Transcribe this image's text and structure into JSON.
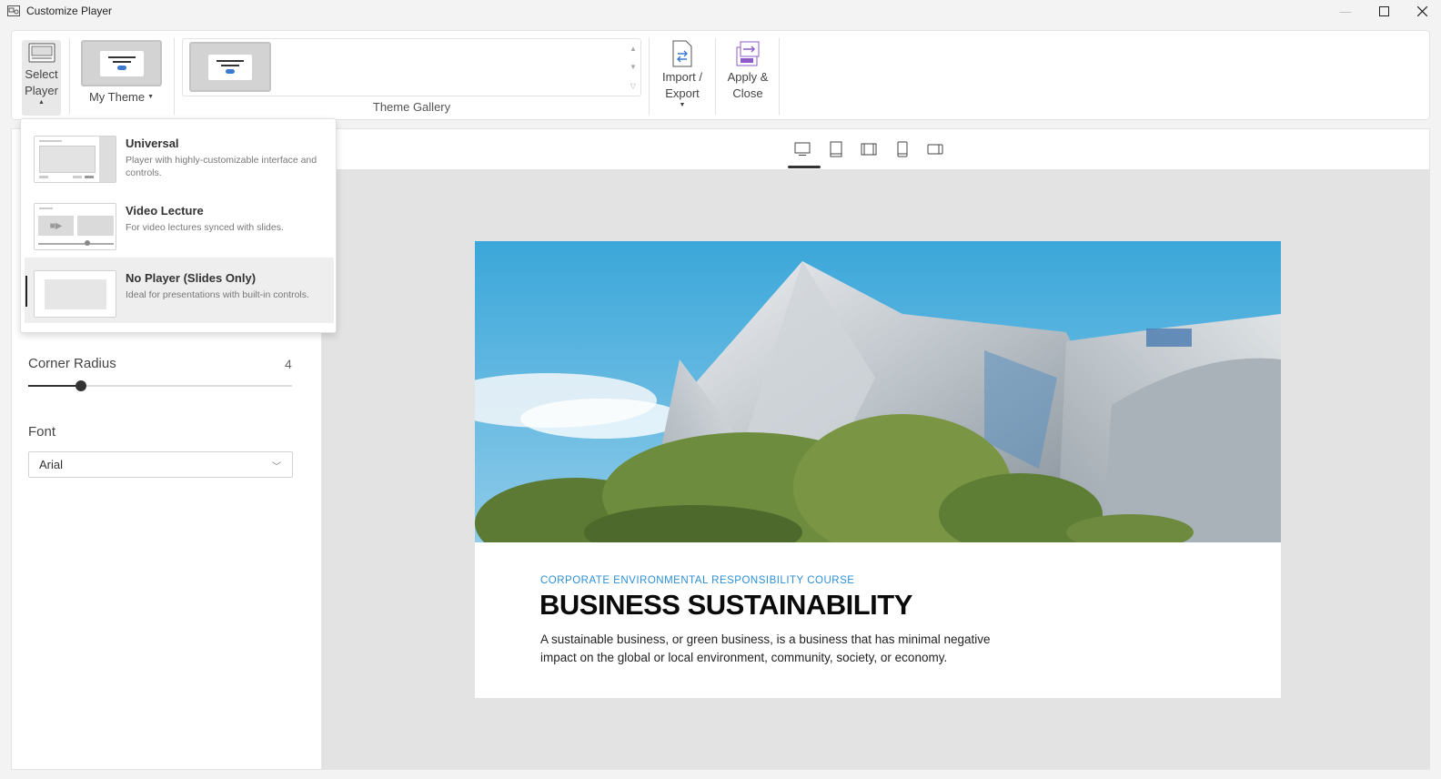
{
  "window": {
    "title": "Customize Player"
  },
  "ribbon": {
    "select_player_label": "Select Player",
    "my_theme_label": "My Theme",
    "gallery_label": "Theme Gallery",
    "import_export_label": "Import / Export",
    "apply_close_label": "Apply & Close"
  },
  "player_menu": {
    "items": [
      {
        "name": "Universal",
        "desc": "Player with highly-customizable interface and controls."
      },
      {
        "name": "Video Lecture",
        "desc": "For video lectures synced with slides."
      },
      {
        "name": "No Player (Slides Only)",
        "desc": "Ideal for presentations with built-in controls.",
        "selected": true
      }
    ]
  },
  "properties": {
    "corner_radius_label": "Corner Radius",
    "corner_radius_value": "4",
    "corner_radius_fraction": 0.2,
    "font_label": "Font",
    "font_value": "Arial"
  },
  "device_preview": {
    "modes": [
      "desktop-icon",
      "tablet-portrait-icon",
      "tablet-landscape-icon",
      "phone-portrait-icon",
      "phone-landscape-icon"
    ],
    "active": "desktop-icon"
  },
  "slide": {
    "subtitle": "CORPORATE ENVIRONMENTAL RESPONSIBILITY COURSE",
    "headline": "BUSINESS SUSTAINABILITY",
    "body": "A sustainable business, or green business, is a business that has minimal negative impact on the global or local environment, community, society, or economy."
  },
  "colors": {
    "accent": "#2d8fd6",
    "theme_dot": "#3c79d0",
    "apply_icon": "#8d5bc8"
  }
}
